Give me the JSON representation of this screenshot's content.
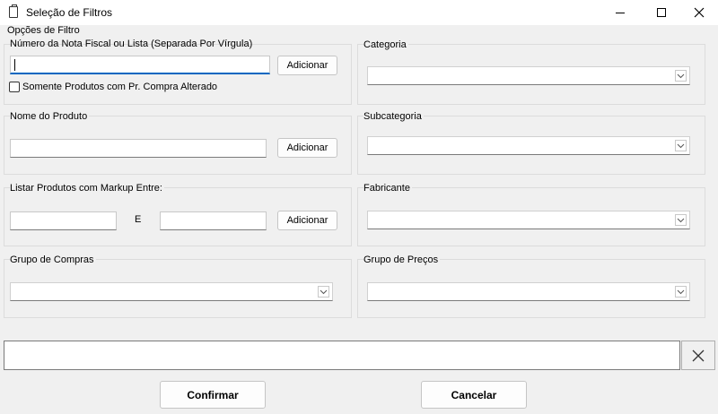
{
  "window": {
    "title": "Seleção de Filtros",
    "icon": "clipboard-icon",
    "controls": {
      "minimize": "minimize-icon",
      "maximize": "maximize-icon",
      "close": "close-icon"
    }
  },
  "options_label": "Opções de Filtro",
  "invoice": {
    "label": "Número da Nota Fiscal ou Lista (Separada Por Vírgula)",
    "value": "",
    "add_label": "Adicionar",
    "checkbox_label": "Somente Produtos com Pr. Compra Alterado",
    "checkbox_checked": false
  },
  "product_name": {
    "label": "Nome do Produto",
    "value": "",
    "add_label": "Adicionar"
  },
  "markup": {
    "label": "Listar Produtos com Markup Entre:",
    "from": "",
    "and_label": "E",
    "to": "",
    "add_label": "Adicionar"
  },
  "purchase_group": {
    "label": "Grupo de Compras",
    "selected": ""
  },
  "category": {
    "label": "Categoria",
    "selected": ""
  },
  "subcategory": {
    "label": "Subcategoria",
    "selected": ""
  },
  "manufacturer": {
    "label": "Fabricante",
    "selected": ""
  },
  "price_group": {
    "label": "Grupo de Preços",
    "selected": ""
  },
  "filter_summary": {
    "value": "",
    "clear_icon": "close-icon"
  },
  "actions": {
    "confirm": "Confirmar",
    "cancel": "Cancelar"
  }
}
